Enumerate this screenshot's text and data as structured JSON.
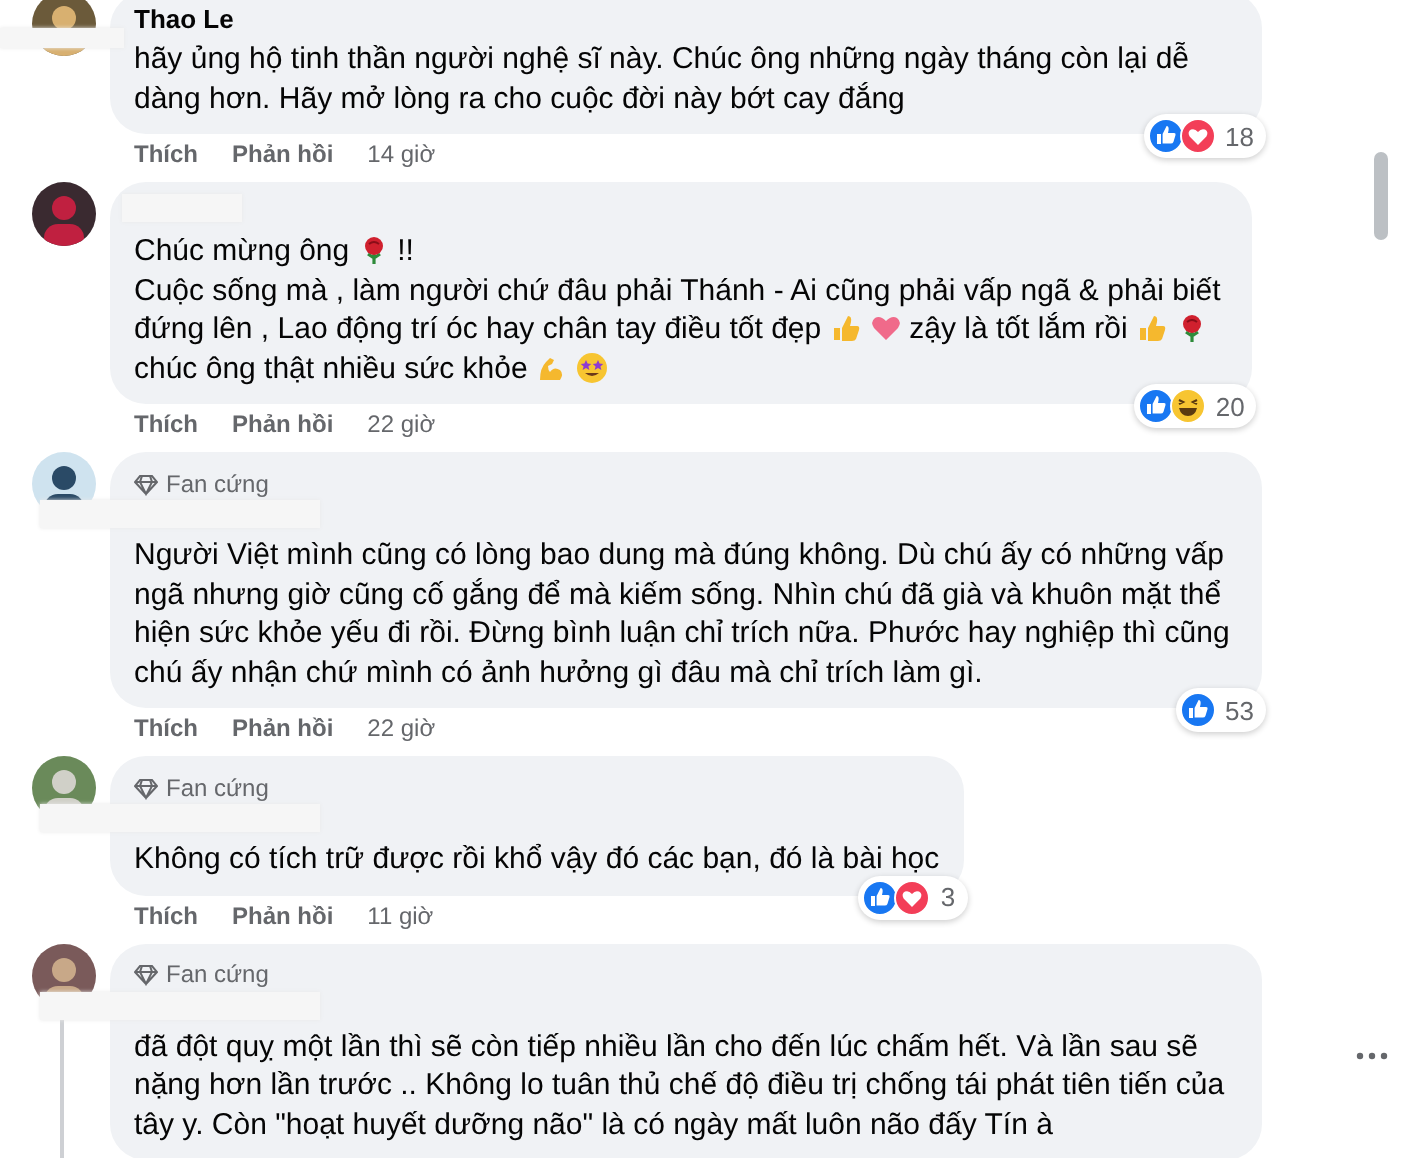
{
  "comments": [
    {
      "name": "Thao Le",
      "parts": [
        {
          "kind": "text",
          "text": "hãy ủng hộ tinh thần người nghệ sĩ này. Chúc ông những ngày tháng còn lại dễ dàng hơn. Hãy mở lòng ra cho cuộc đời này bớt cay đắng"
        }
      ],
      "actions": [
        "Thích",
        "Phản hồi"
      ],
      "time": "14 giờ",
      "reactions": [
        {
          "kind": "like"
        },
        {
          "kind": "love"
        }
      ],
      "reaction_count": "18"
    },
    {
      "parts": [
        {
          "kind": "line",
          "text": "Chúc mừng ông"
        },
        {
          "kind": "rose"
        },
        {
          "kind": "line",
          "text": "!!"
        },
        {
          "kind": "break"
        },
        {
          "kind": "line",
          "text": "Cuộc sống mà , làm người chứ đâu phải Thánh - Ai cũng phải vấp ngã & phải biết"
        },
        {
          "kind": "break"
        },
        {
          "kind": "line",
          "text": "đứng lên , Lao động trí óc hay chân tay điều tốt đẹp"
        },
        {
          "kind": "thumb"
        },
        {
          "kind": "heart"
        },
        {
          "kind": "line",
          "text": "zậy là tốt lắm rồi"
        },
        {
          "kind": "thumb"
        },
        {
          "kind": "rose"
        },
        {
          "kind": "break"
        },
        {
          "kind": "line",
          "text": "chúc ông thật nhiều sức khỏe"
        },
        {
          "kind": "muscle"
        },
        {
          "kind": "starstruck"
        }
      ],
      "actions": [
        "Thích",
        "Phản hồi"
      ],
      "time": "22 giờ",
      "reactions": [
        {
          "kind": "like"
        },
        {
          "kind": "haha"
        }
      ],
      "reaction_count": "20"
    },
    {
      "badge": "Fan cứng",
      "parts": [
        {
          "kind": "text",
          "text": "Người Việt mình cũng có lòng bao dung mà đúng không. Dù chú ấy có những vấp ngã nhưng giờ cũng cố gắng để mà kiếm sống. Nhìn chú đã già và khuôn mặt thể hiện sức khỏe yếu đi rồi. Đừng bình luận chỉ trích nữa. Phước hay nghiệp thì cũng chú ấy nhận chứ mình có ảnh hưởng gì đâu mà chỉ trích làm gì."
        }
      ],
      "actions": [
        "Thích",
        "Phản hồi"
      ],
      "time": "22 giờ",
      "reactions": [
        {
          "kind": "like"
        }
      ],
      "reaction_count": "53"
    },
    {
      "badge": "Fan cứng",
      "parts": [
        {
          "kind": "text",
          "text": "Không có tích trữ được rồi khổ vậy đó các bạn, đó là bài học"
        }
      ],
      "actions": [
        "Thích",
        "Phản hồi"
      ],
      "time": "11 giờ",
      "reactions": [
        {
          "kind": "like"
        },
        {
          "kind": "love"
        }
      ],
      "reaction_count": "3"
    },
    {
      "badge": "Fan cứng",
      "parts": [
        {
          "kind": "text",
          "text": "đã đột quỵ một lần thì sẽ còn tiếp nhiều lần cho đến lúc chấm hết. Và lần sau sẽ nặng hơn lần trước .. Không lo tuân thủ chế độ điều trị chống tái phát tiên tiến của tây y. Còn \"hoạt huyết dưỡng não\" là có ngày mất luôn não đấy Tín à"
        }
      ],
      "has_replies": true,
      "more": true
    }
  ]
}
